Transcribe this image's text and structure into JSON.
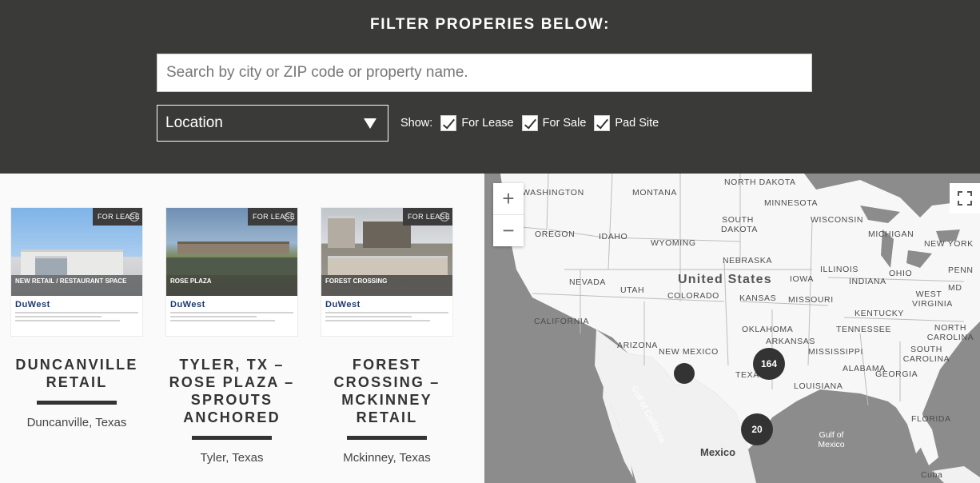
{
  "filter": {
    "title": "FILTER PROPERIES BELOW:",
    "search_placeholder": "Search by city or ZIP code or property name.",
    "location_select": "Location",
    "show_label": "Show:",
    "checkboxes": [
      {
        "label": "For Lease",
        "checked": true
      },
      {
        "label": "For Sale",
        "checked": true
      },
      {
        "label": "Pad Site",
        "checked": true
      }
    ]
  },
  "listings": [
    {
      "title": "DUNCANVILLE RETAIL",
      "location": "Duncanville, Texas",
      "badge": "FOR LEASE",
      "image_banner": "NEW RETAIL / RESTAURANT SPACE",
      "logo": "DuWest"
    },
    {
      "title": "TYLER, TX – ROSE PLAZA – SPROUTS ANCHORED",
      "location": "Tyler, Texas",
      "badge": "FOR LEASE",
      "image_banner": "ROSE PLAZA",
      "logo": "DuWest"
    },
    {
      "title": "FOREST CROSSING – MCKINNEY RETAIL",
      "location": "Mckinney, Texas",
      "badge": "FOR LEASE",
      "image_banner": "FOREST CROSSING",
      "logo": "DuWest"
    }
  ],
  "map": {
    "country_label": "United States",
    "country_mexico": "Mexico",
    "state_labels": [
      "WASHINGTON",
      "MONTANA",
      "NORTH DAKOTA",
      "MINNESOTA",
      "SOUTH DAKOTA",
      "WISCONSIN",
      "MICHIGAN",
      "NEW YORK",
      "OREGON",
      "IDAHO",
      "WYOMING",
      "NEBRASKA",
      "IOWA",
      "ILLINOIS",
      "INDIANA",
      "OHIO",
      "PENN",
      "NEVADA",
      "UTAH",
      "COLORADO",
      "KANSAS",
      "MISSOURI",
      "KENTUCKY",
      "WEST VIRGINIA",
      "CALIFORNIA",
      "OKLAHOMA",
      "TENNESSEE",
      "NORTH CAROLINA",
      "ARIZONA",
      "NEW MEXICO",
      "ARKANSAS",
      "MISSISSIPPI",
      "SOUTH CAROLINA",
      "ALABAMA",
      "GEORGIA",
      "TEXAS",
      "LOUISIANA",
      "FLORIDA",
      "MD"
    ],
    "sea_labels": [
      "Gulf of California",
      "Gulf of Mexico",
      "Cuba"
    ],
    "zoom_in": "+",
    "zoom_out": "−",
    "clusters": [
      {
        "count": "164"
      },
      {
        "count": "20"
      },
      {
        "count": ""
      }
    ]
  }
}
